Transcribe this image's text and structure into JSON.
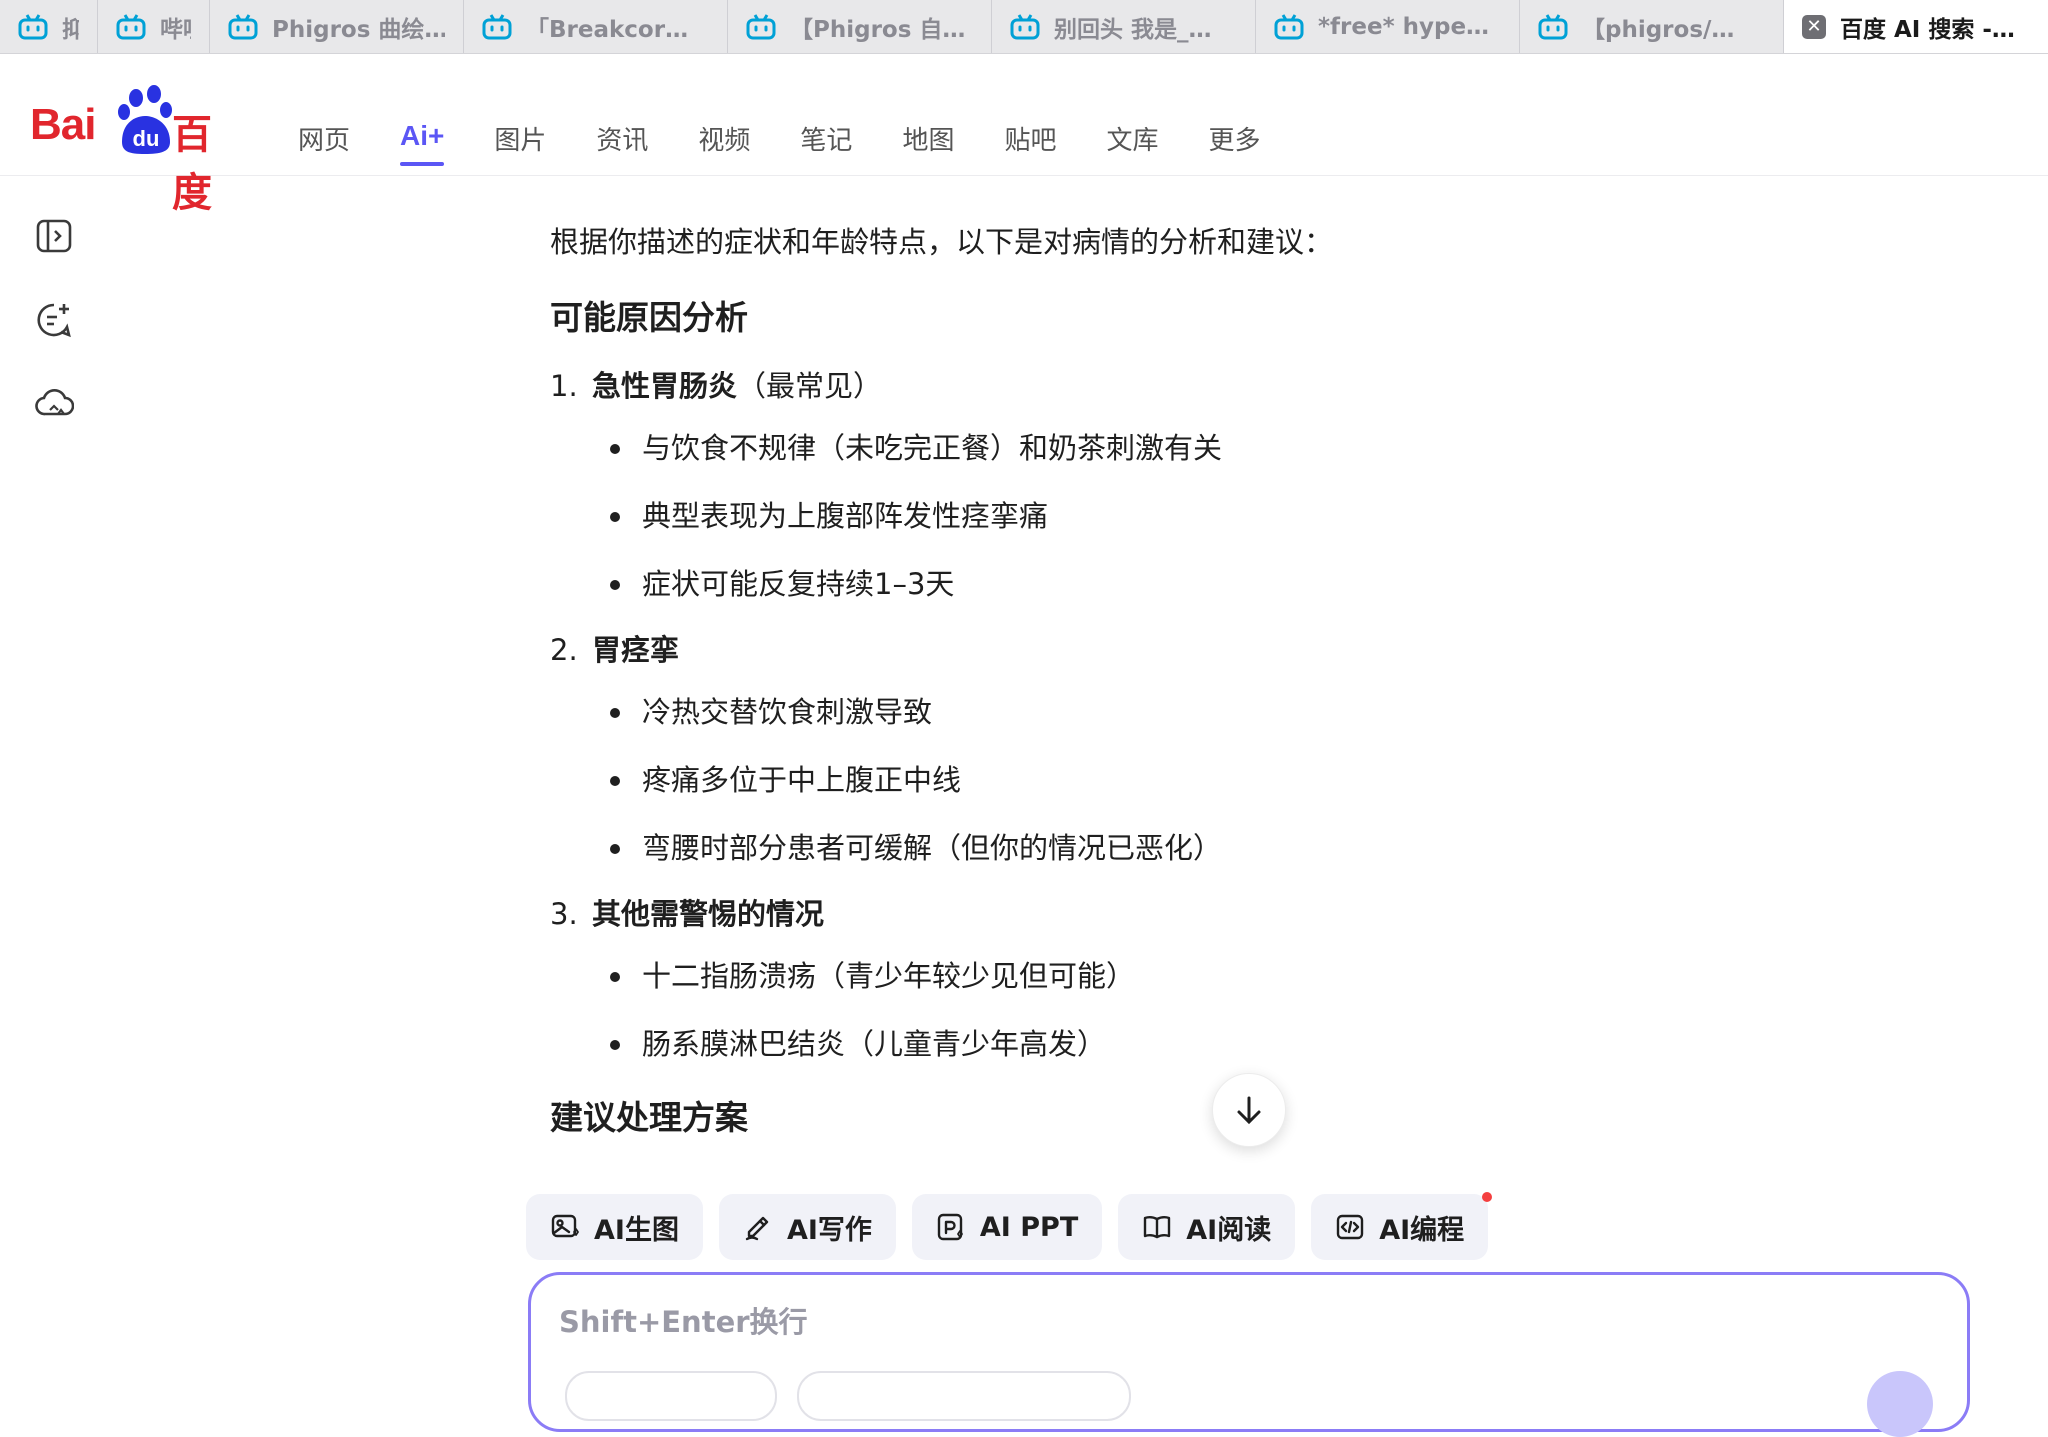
{
  "tabs": [
    {
      "label": "抑 ",
      "icon": "bilibili-tv-icon",
      "active": false,
      "width": 98
    },
    {
      "label": "哔哩",
      "icon": "bilibili-tv-icon",
      "active": false,
      "width": 112
    },
    {
      "label": "Phigros 曲绘…",
      "icon": "bilibili-tv-icon",
      "active": false,
      "width": 254
    },
    {
      "label": "「Breakcor…",
      "icon": "bilibili-tv-icon",
      "active": false,
      "width": 264
    },
    {
      "label": "【Phigros 自…",
      "icon": "bilibili-tv-icon",
      "active": false,
      "width": 264
    },
    {
      "label": "别回头 我是_…",
      "icon": "bilibili-tv-icon",
      "active": false,
      "width": 264
    },
    {
      "label": "*free* hype…",
      "icon": "bilibili-tv-icon",
      "active": false,
      "width": 264
    },
    {
      "label": "【phigros/…",
      "icon": "bilibili-tv-icon",
      "active": false,
      "width": 264
    },
    {
      "label": "百度 AI 搜索 -…",
      "icon": "close-icon",
      "active": true,
      "width": 264
    }
  ],
  "logo": {
    "bai": "Bai",
    "du": "du",
    "cn": "百度"
  },
  "nav": [
    "网页",
    "Ai+",
    "图片",
    "资讯",
    "视频",
    "笔记",
    "地图",
    "贴吧",
    "文库",
    "更多"
  ],
  "article": {
    "intro": "根据你描述的症状和年龄特点，以下是对病情的分析和建议：",
    "section1_title": "可能原因分析",
    "causes": [
      {
        "num": "1.",
        "title": "急性胃肠炎",
        "note": "（最常见）",
        "points": [
          "与饮食不规律（未吃完正餐）和奶茶刺激有关",
          "典型表现为上腹部阵发性痉挛痛",
          "症状可能反复持续1–3天"
        ]
      },
      {
        "num": "2.",
        "title": "胃痉挛",
        "note": "",
        "points": [
          "冷热交替饮食刺激导致",
          "疼痛多位于中上腹正中线",
          "弯腰时部分患者可缓解（但你的情况已恶化）"
        ]
      },
      {
        "num": "3.",
        "title": "其他需警惕的情况",
        "note": "",
        "points": [
          "十二指肠溃疡（青少年较少见但可能）",
          "肠系膜淋巴结炎（儿童青少年高发）"
        ]
      }
    ],
    "section2_title": "建议处理方案"
  },
  "tools": [
    {
      "label": "AI生图",
      "icon": "image-gen-icon"
    },
    {
      "label": "AI写作",
      "icon": "pen-write-icon"
    },
    {
      "label": "AI PPT",
      "icon": "ppt-icon"
    },
    {
      "label": "AI阅读",
      "icon": "book-read-icon"
    },
    {
      "label": "AI编程",
      "icon": "code-icon"
    }
  ],
  "input": {
    "placeholder": "Shift+Enter换行",
    "value": ""
  },
  "colors": {
    "accent": "#5b56f5",
    "brand_red": "#e1262d",
    "bilibili_blue": "#00a1d6",
    "input_border": "#8b7cf6"
  }
}
